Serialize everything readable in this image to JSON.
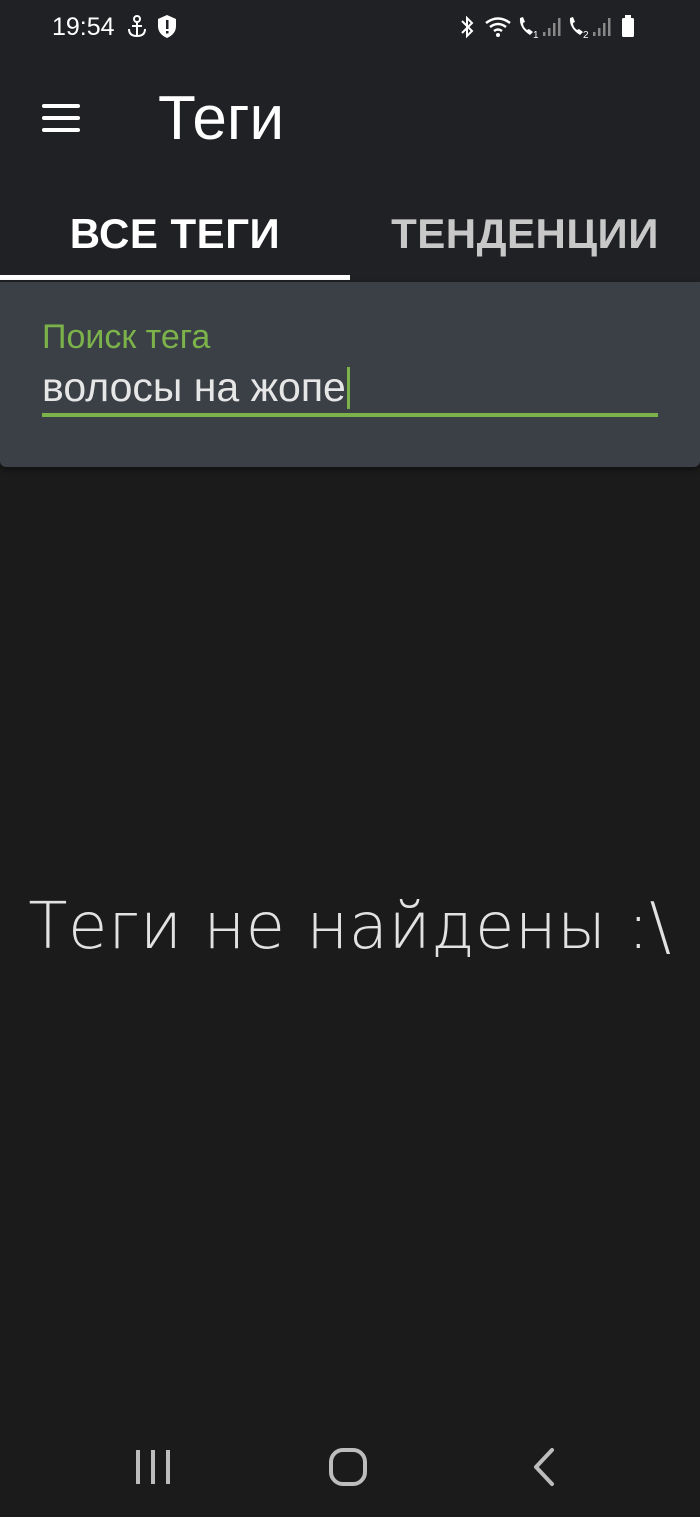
{
  "status_bar": {
    "time": "19:54",
    "left_icons": [
      "anchor-icon",
      "shield-alert-icon"
    ],
    "right_icons": [
      "bluetooth-icon",
      "wifi-icon",
      "call-sim1-icon",
      "signal-sim1-icon",
      "call-sim2-icon",
      "signal-sim2-icon",
      "battery-icon"
    ]
  },
  "toolbar": {
    "title": "Теги",
    "menu_icon": "hamburger-menu-icon"
  },
  "tabs": [
    {
      "label": "ВСЕ ТЕГИ",
      "selected": true
    },
    {
      "label": "ТЕНДЕНЦИИ",
      "selected": false
    }
  ],
  "search": {
    "label": "Поиск тега",
    "value": "волосы на жопе"
  },
  "empty_state": {
    "message": "Теги не найдены :\\"
  },
  "nav_bar": {
    "buttons": [
      "recent-apps-icon",
      "home-icon",
      "back-icon"
    ]
  },
  "colors": {
    "header_bg": "#1f2124",
    "body_bg": "#1b1b1b",
    "panel_bg": "#3b4047",
    "accent": "#7cb24a"
  }
}
